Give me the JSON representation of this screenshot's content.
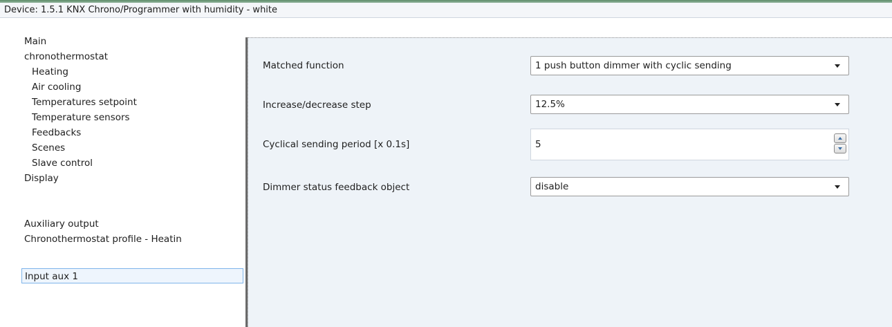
{
  "window": {
    "title": "Device: 1.5.1  KNX Chrono/Programmer with humidity - white"
  },
  "sidebar": {
    "items": [
      {
        "label": "Main"
      },
      {
        "label": "chronothermostat"
      },
      {
        "label": "Heating"
      },
      {
        "label": "Air cooling"
      },
      {
        "label": "Temperatures setpoint"
      },
      {
        "label": "Temperature sensors"
      },
      {
        "label": "Feedbacks"
      },
      {
        "label": "Scenes"
      },
      {
        "label": "Slave control"
      },
      {
        "label": "Display"
      },
      {
        "label": "Input aux 1"
      },
      {
        "label": "Auxiliary output"
      },
      {
        "label": "Chronothermostat profile - Heatin"
      }
    ]
  },
  "params": [
    {
      "label": "Matched function",
      "value": "1 push button dimmer with cyclic sending"
    },
    {
      "label": "Increase/decrease step",
      "value": "12.5%"
    },
    {
      "label": "Cyclical sending period [x 0.1s]",
      "value": "5"
    },
    {
      "label": "Dimmer status feedback object",
      "value": "disable"
    }
  ],
  "colors": {
    "selection_border": "#7eb4ea",
    "selection_fill": "#eef5fd",
    "panel_background": "#eef3f8",
    "accent": "#5f8c6a"
  }
}
